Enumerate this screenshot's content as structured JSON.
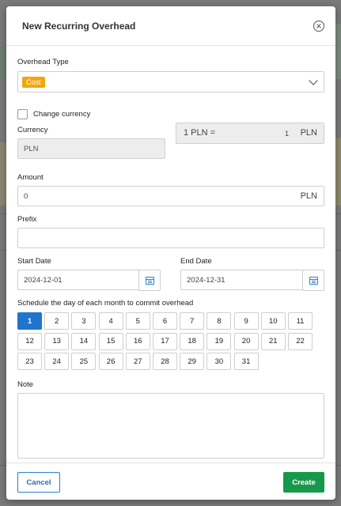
{
  "modal": {
    "title": "New Recurring Overhead"
  },
  "form": {
    "overhead_type_label": "Overhead Type",
    "overhead_type_value": "Cost",
    "change_currency_label": "Change currency",
    "currency_label": "Currency",
    "currency_value": "PLN",
    "rate": {
      "left": "1 PLN =",
      "value": "1",
      "unit": "PLN"
    },
    "amount_label": "Amount",
    "amount_value": "0",
    "amount_unit": "PLN",
    "prefix_label": "Prefix",
    "prefix_value": "",
    "start_date_label": "Start Date",
    "start_date_value": "2024-12-01",
    "end_date_label": "End Date",
    "end_date_value": "2024-12-31",
    "schedule_label": "Schedule the day of each month to commit overhead",
    "selected_day": 1,
    "days": [
      "1",
      "2",
      "3",
      "4",
      "5",
      "6",
      "7",
      "8",
      "9",
      "10",
      "11",
      "12",
      "13",
      "14",
      "15",
      "16",
      "17",
      "18",
      "19",
      "20",
      "21",
      "22",
      "23",
      "24",
      "25",
      "26",
      "27",
      "28",
      "29",
      "30",
      "31"
    ],
    "note_label": "Note",
    "note_value": ""
  },
  "footer": {
    "cancel_label": "Cancel",
    "create_label": "Create"
  },
  "colors": {
    "accent": "#1f75cc",
    "badge": "#f0a80e",
    "create": "#16994a"
  },
  "icons": {
    "close": "close-circle-icon",
    "dropdown": "chevron-down-icon",
    "date": "calendar-icon"
  }
}
